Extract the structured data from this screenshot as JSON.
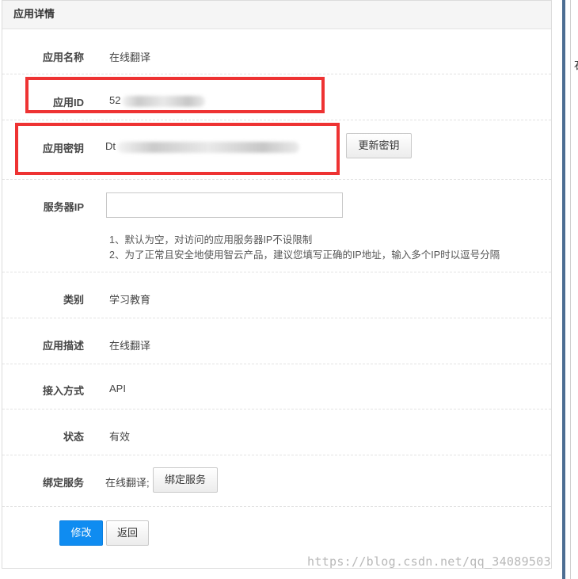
{
  "panel": {
    "title": "应用详情"
  },
  "fields": {
    "app_name": {
      "label": "应用名称",
      "value": "在线翻译"
    },
    "app_id": {
      "label": "应用ID",
      "value": "52"
    },
    "app_secret": {
      "label": "应用密钥",
      "value": "Dt",
      "refresh_button": "更新密钥"
    },
    "server_ip": {
      "label": "服务器IP",
      "input_value": "",
      "hint1": "1、默认为空，对访问的应用服务器IP不设限制",
      "hint2": "2、为了正常且安全地使用智云产品，建议您填写正确的IP地址，输入多个IP时以逗号分隔"
    },
    "category": {
      "label": "类别",
      "value": "学习教育"
    },
    "description": {
      "label": "应用描述",
      "value": "在线翻译"
    },
    "access_method": {
      "label": "接入方式",
      "value": "API"
    },
    "status": {
      "label": "状态",
      "value": "有效"
    },
    "bound_service": {
      "label": "绑定服务",
      "value": "在线翻译;",
      "bind_button": "绑定服务"
    }
  },
  "actions": {
    "modify": "修改",
    "back": "返回"
  },
  "right_edge_glyph": "石",
  "watermark": "https://blog.csdn.net/qq_34089503",
  "colors": {
    "primary": "#0f8cf1",
    "highlight_box": "#ee3333"
  }
}
